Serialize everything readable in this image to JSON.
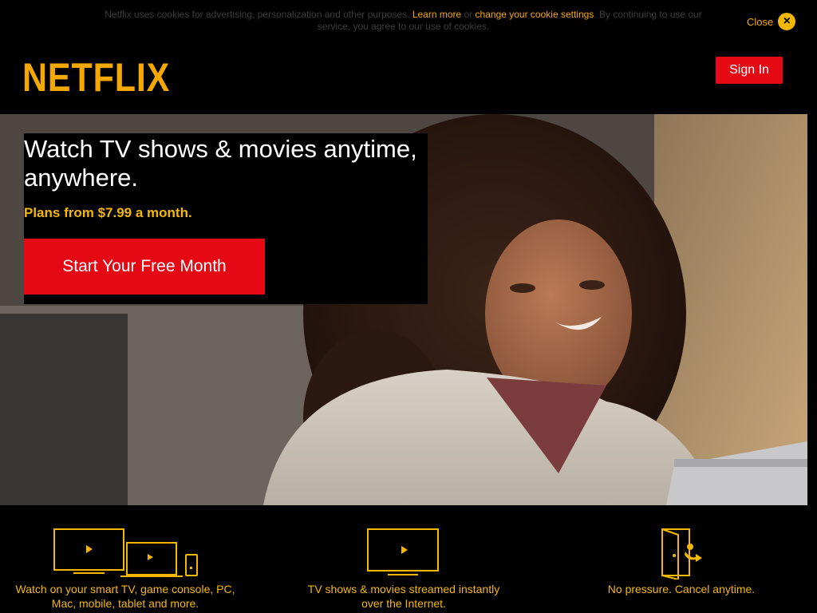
{
  "cookie_notice": {
    "text_before": "Netflix uses cookies for advertising, personalization and other purposes.",
    "learn_more": "Learn more",
    "or": "or",
    "settings_link": "change your cookie settings",
    "text_after": ". By continuing to use our service, you agree to our use of cookies.",
    "close_label": "Close",
    "close_icon": "×"
  },
  "header": {
    "logo": "NETFLIX",
    "sign_in": "Sign In"
  },
  "hero": {
    "headline": "Watch TV shows & movies anytime, anywhere.",
    "plans": "Plans from $7.99 a month.",
    "cta": "Start Your Free Month"
  },
  "features": [
    {
      "icon": "devices-icon",
      "text": "Watch on your smart TV, game console, PC, Mac, mobile, tablet and more."
    },
    {
      "icon": "tv-play-icon",
      "text": "TV shows & movies streamed instantly over the Internet."
    },
    {
      "icon": "door-exit-icon",
      "text": "No pressure. Cancel anytime."
    }
  ],
  "colors": {
    "brand_red": "#e50914",
    "accent_gold": "#f5a900",
    "background": "#000000"
  }
}
